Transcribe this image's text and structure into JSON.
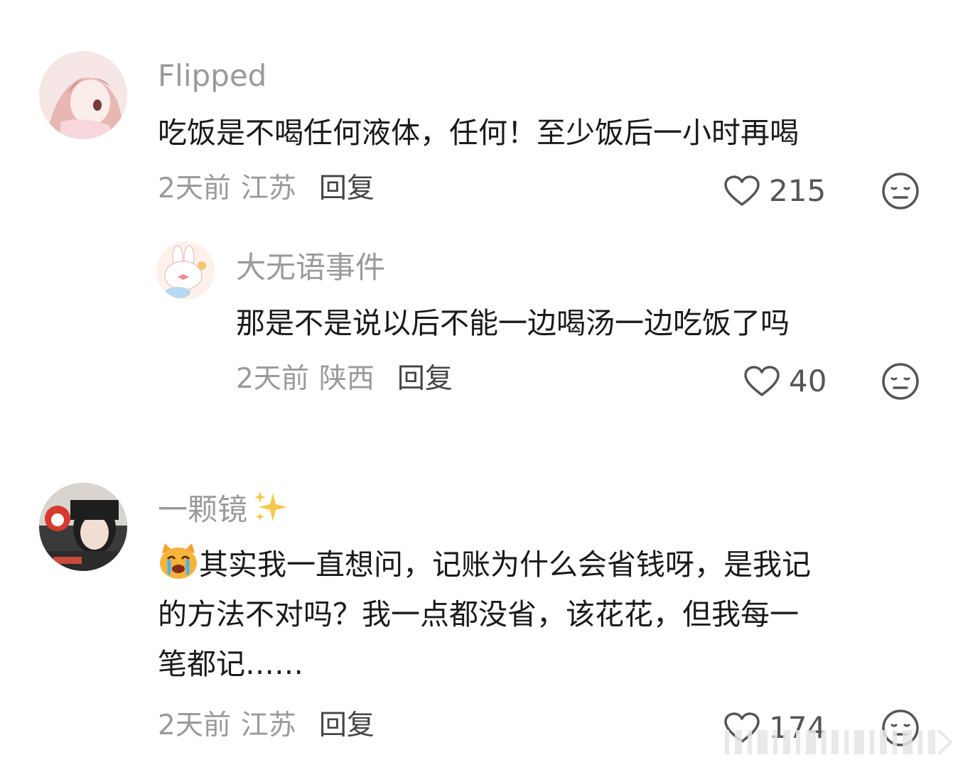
{
  "comments": [
    {
      "username": "Flipped",
      "text_lines": [
        "吃饭是不喝任何液体，任何！至少饭后一小时再喝"
      ],
      "time": "2天前",
      "location": "江苏",
      "reply_label": "回复",
      "likes": "215",
      "avatar_icon": "anime-girl-avatar"
    },
    {
      "username": "大无语事件",
      "text_lines": [
        "那是不是说以后不能一边喝汤一边吃饭了吗"
      ],
      "time": "2天前",
      "location": "陕西",
      "reply_label": "回复",
      "likes": "40",
      "avatar_icon": "bunny-avatar"
    },
    {
      "username": "一颗镜",
      "username_emoji": "sparkles-icon",
      "text_lines": [
        "其实我一直想问，记账为什么会省钱呀，是我记",
        "的方法不对吗？我一点都没省，该花花，但我每一",
        "笔都记……"
      ],
      "leading_emoji": "crying-cat-emoji",
      "time": "2天前",
      "location": "江苏",
      "reply_label": "回复",
      "likes": "174",
      "avatar_icon": "girl-photo-avatar"
    }
  ],
  "colors": {
    "username": "#9a9a9a",
    "text": "#1a1a1a",
    "meta": "#9a9a9a",
    "icon": "#555555"
  }
}
